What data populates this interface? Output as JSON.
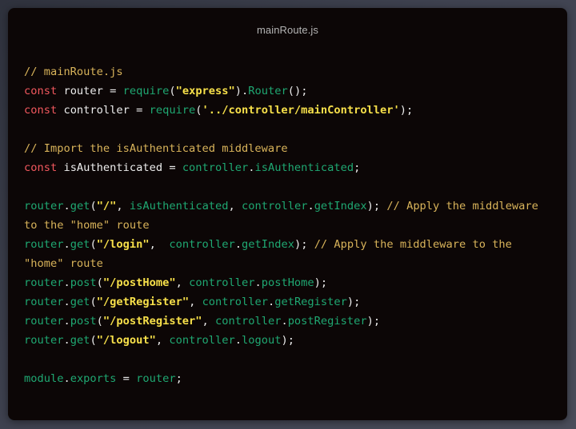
{
  "window": {
    "title": "mainRoute.js"
  },
  "code": {
    "l1_comment": "// mainRoute.js",
    "l2_kw": "const",
    "l2_name": "router",
    "l2_eq": "=",
    "l2_require": "require",
    "l2_open": "(",
    "l2_str": "\"express\"",
    "l2_close": ")",
    "l2_dot": ".",
    "l2_router": "Router",
    "l2_end": "();",
    "l3_kw": "const",
    "l3_name": "controller",
    "l3_eq": "=",
    "l3_require": "require",
    "l3_open": "(",
    "l3_str": "'../controller/mainController'",
    "l3_end": ");",
    "l5_comment": "// Import the isAuthenticated middleware",
    "l6_kw": "const",
    "l6_name": "isAuthenticated",
    "l6_eq": "=",
    "l6_obj": "controller",
    "l6_dot": ".",
    "l6_prop": "isAuthenticated",
    "l6_end": ";",
    "l8_router": "router",
    "l8_dot": ".",
    "l8_method": "get",
    "l8_open": "(",
    "l8_str": "\"/\"",
    "l8_comma": ",",
    "l8_mw": "isAuthenticated",
    "l8_comma2": ",",
    "l8_obj": "controller",
    "l8_dot2": ".",
    "l8_handler": "getIndex",
    "l8_end": ");",
    "l8_comment": "// Apply the middleware to the \"home\" route",
    "l9_router": "router",
    "l9_dot": ".",
    "l9_method": "get",
    "l9_open": "(",
    "l9_str": "\"/login\"",
    "l9_comma": ",",
    "l9_obj": "controller",
    "l9_dot2": ".",
    "l9_handler": "getIndex",
    "l9_end": ");",
    "l9_comment": "// Apply the middleware to the \"home\" route",
    "l10_router": "router",
    "l10_dot": ".",
    "l10_method": "post",
    "l10_open": "(",
    "l10_str": "\"/postHome\"",
    "l10_comma": ",",
    "l10_obj": "controller",
    "l10_dot2": ".",
    "l10_handler": "postHome",
    "l10_end": ");",
    "l11_router": "router",
    "l11_dot": ".",
    "l11_method": "get",
    "l11_open": "(",
    "l11_str": "\"/getRegister\"",
    "l11_comma": ",",
    "l11_obj": "controller",
    "l11_dot2": ".",
    "l11_handler": "getRegister",
    "l11_end": ");",
    "l12_router": "router",
    "l12_dot": ".",
    "l12_method": "post",
    "l12_open": "(",
    "l12_str": "\"/postRegister\"",
    "l12_comma": ",",
    "l12_obj": "controller",
    "l12_dot2": ".",
    "l12_handler": "postRegister",
    "l12_end": ");",
    "l13_router": "router",
    "l13_dot": ".",
    "l13_method": "get",
    "l13_open": "(",
    "l13_str": "\"/logout\"",
    "l13_comma": ",",
    "l13_obj": "controller",
    "l13_dot2": ".",
    "l13_handler": "logout",
    "l13_end": ");",
    "l15_module": "module",
    "l15_dot": ".",
    "l15_exports": "exports",
    "l15_eq": "=",
    "l15_router": "router",
    "l15_end": ";"
  },
  "colors": {
    "comment": "#d8b35a",
    "keyword": "#f2585e",
    "string": "#f7e04a",
    "function": "#1fa872",
    "background": "#0c0606"
  }
}
